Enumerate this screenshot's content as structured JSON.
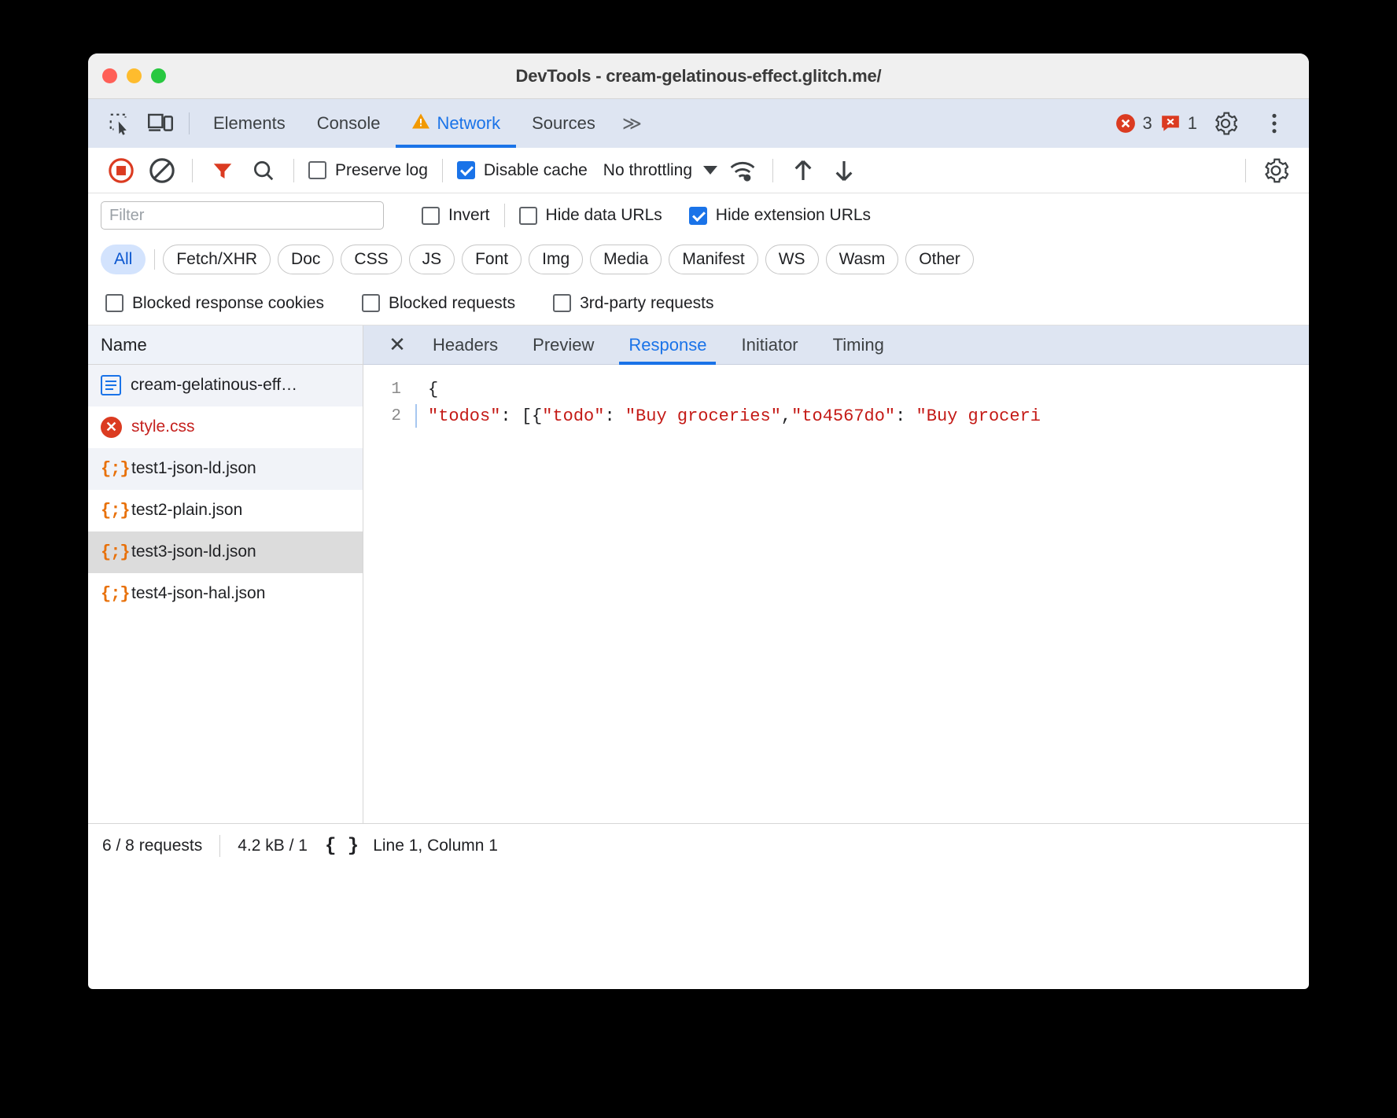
{
  "window": {
    "title": "DevTools - cream-gelatinous-effect.glitch.me/",
    "traffic_lights": [
      "close",
      "minimize",
      "maximize"
    ]
  },
  "devtools_tabbar": {
    "icons": [
      "inspect-element-icon",
      "device-toolbar-icon"
    ],
    "tabs": [
      {
        "label": "Elements",
        "selected": false,
        "warning": false
      },
      {
        "label": "Console",
        "selected": false,
        "warning": false
      },
      {
        "label": "Network",
        "selected": true,
        "warning": true
      },
      {
        "label": "Sources",
        "selected": false,
        "warning": false
      }
    ],
    "more_tabs": "≫",
    "error_count": "3",
    "issue_count": "1",
    "settings_icon": "gear-icon",
    "more_menu_icon": "kebab-menu-icon"
  },
  "network_toolbar": {
    "record_title": "record-button",
    "clear_title": "clear-button",
    "filter_icon": "filter-funnel-icon",
    "search_icon": "search-icon",
    "preserve_log": {
      "label": "Preserve log",
      "checked": false
    },
    "disable_cache": {
      "label": "Disable cache",
      "checked": true
    },
    "throttling": {
      "value": "No throttling"
    },
    "wifi_icon": "network-conditions-icon",
    "import_icon": "import-har-icon",
    "export_icon": "export-har-icon",
    "settings_icon": "network-settings-gear-icon"
  },
  "filter_row": {
    "filter_placeholder": "Filter",
    "filter_value": "",
    "invert": {
      "label": "Invert",
      "checked": false
    },
    "hide_data_urls": {
      "label": "Hide data URLs",
      "checked": false
    },
    "hide_extension_urls": {
      "label": "Hide extension URLs",
      "checked": true
    }
  },
  "type_filters": [
    {
      "label": "All",
      "active": true
    },
    {
      "label": "Fetch/XHR",
      "active": false
    },
    {
      "label": "Doc",
      "active": false
    },
    {
      "label": "CSS",
      "active": false
    },
    {
      "label": "JS",
      "active": false
    },
    {
      "label": "Font",
      "active": false
    },
    {
      "label": "Img",
      "active": false
    },
    {
      "label": "Media",
      "active": false
    },
    {
      "label": "Manifest",
      "active": false
    },
    {
      "label": "WS",
      "active": false
    },
    {
      "label": "Wasm",
      "active": false
    },
    {
      "label": "Other",
      "active": false
    }
  ],
  "blocked_row": [
    {
      "label": "Blocked response cookies",
      "checked": false
    },
    {
      "label": "Blocked requests",
      "checked": false
    },
    {
      "label": "3rd-party requests",
      "checked": false
    }
  ],
  "request_list": {
    "column_header": "Name",
    "rows": [
      {
        "name": "cream-gelatinous-eff…",
        "icon": "document-icon",
        "state": "alt",
        "error": false
      },
      {
        "name": "style.css",
        "icon": "error-circle-icon",
        "state": "normal",
        "error": true
      },
      {
        "name": "test1-json-ld.json",
        "icon": "json-braces-icon",
        "state": "alt",
        "error": false
      },
      {
        "name": "test2-plain.json",
        "icon": "json-braces-icon",
        "state": "normal",
        "error": false
      },
      {
        "name": "test3-json-ld.json",
        "icon": "json-braces-icon",
        "state": "selected",
        "error": false
      },
      {
        "name": "test4-json-hal.json",
        "icon": "json-braces-icon",
        "state": "normal",
        "error": false
      }
    ]
  },
  "detail_panel": {
    "close_label": "✕",
    "tabs": [
      {
        "label": "Headers",
        "selected": false
      },
      {
        "label": "Preview",
        "selected": false
      },
      {
        "label": "Response",
        "selected": true
      },
      {
        "label": "Initiator",
        "selected": false
      },
      {
        "label": "Timing",
        "selected": false
      }
    ],
    "code": {
      "line1_number": "1",
      "line1_text": "{",
      "line2_number": "2",
      "line2_parts": {
        "key_todos": "\"todos\"",
        "colon1": ": [{",
        "key_todo": "\"todo\"",
        "colon2": ": ",
        "val_groceries": "\"Buy groceries\"",
        "comma": ",",
        "key_to4567do": "\"to4567do\"",
        "colon3": ": ",
        "val_groceries2": "\"Buy groceri"
      }
    }
  },
  "status_bar": {
    "requests": "6 / 8 requests",
    "transferred": "4.2 kB / 1",
    "format_icon": "pretty-print-braces-icon",
    "cursor_position": "Line 1, Column 1"
  }
}
